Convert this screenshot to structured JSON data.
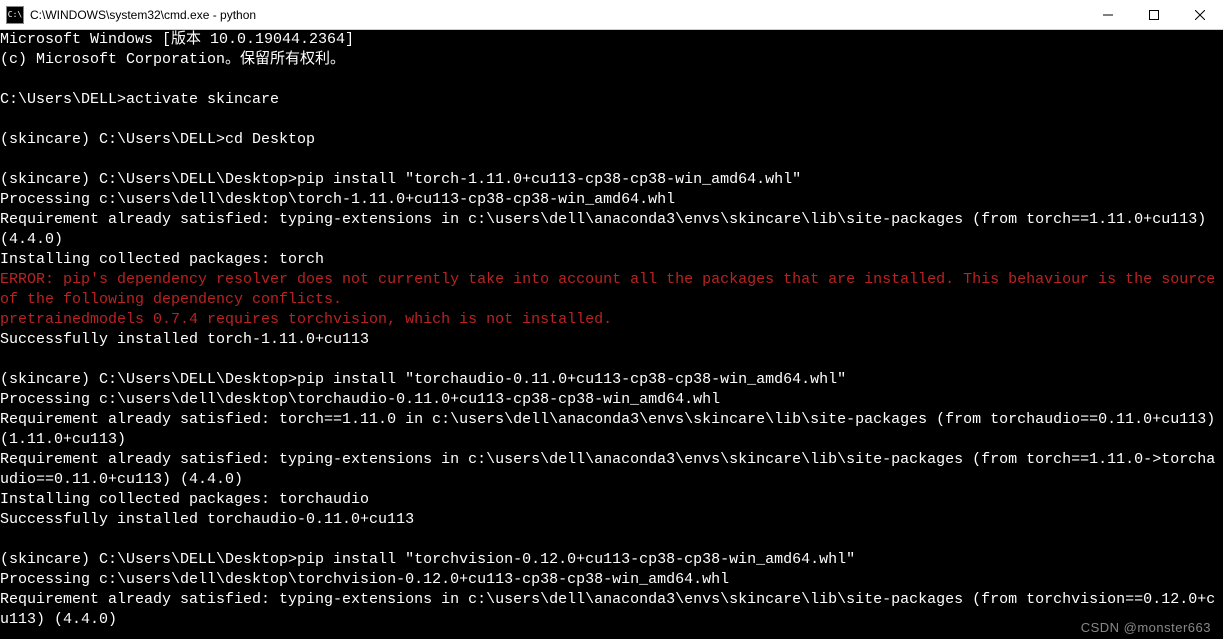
{
  "window": {
    "icon_label": "C:\\",
    "title": "C:\\WINDOWS\\system32\\cmd.exe - python"
  },
  "lines": [
    {
      "t": "Microsoft Windows [版本 10.0.19044.2364]",
      "c": "n"
    },
    {
      "t": "(c) Microsoft Corporation。保留所有权利。",
      "c": "n"
    },
    {
      "t": "",
      "c": "n"
    },
    {
      "t": "C:\\Users\\DELL>activate skincare",
      "c": "n"
    },
    {
      "t": "",
      "c": "n"
    },
    {
      "t": "(skincare) C:\\Users\\DELL>cd Desktop",
      "c": "n"
    },
    {
      "t": "",
      "c": "n"
    },
    {
      "t": "(skincare) C:\\Users\\DELL\\Desktop>pip install \"torch-1.11.0+cu113-cp38-cp38-win_amd64.whl\"",
      "c": "n"
    },
    {
      "t": "Processing c:\\users\\dell\\desktop\\torch-1.11.0+cu113-cp38-cp38-win_amd64.whl",
      "c": "n"
    },
    {
      "t": "Requirement already satisfied: typing-extensions in c:\\users\\dell\\anaconda3\\envs\\skincare\\lib\\site-packages (from torch==1.11.0+cu113) (4.4.0)",
      "c": "n"
    },
    {
      "t": "Installing collected packages: torch",
      "c": "n"
    },
    {
      "t": "ERROR: pip's dependency resolver does not currently take into account all the packages that are installed. This behaviour is the source of the following dependency conflicts.",
      "c": "e"
    },
    {
      "t": "pretrainedmodels 0.7.4 requires torchvision, which is not installed.",
      "c": "e"
    },
    {
      "t": "Successfully installed torch-1.11.0+cu113",
      "c": "n"
    },
    {
      "t": "",
      "c": "n"
    },
    {
      "t": "(skincare) C:\\Users\\DELL\\Desktop>pip install \"torchaudio-0.11.0+cu113-cp38-cp38-win_amd64.whl\"",
      "c": "n"
    },
    {
      "t": "Processing c:\\users\\dell\\desktop\\torchaudio-0.11.0+cu113-cp38-cp38-win_amd64.whl",
      "c": "n"
    },
    {
      "t": "Requirement already satisfied: torch==1.11.0 in c:\\users\\dell\\anaconda3\\envs\\skincare\\lib\\site-packages (from torchaudio==0.11.0+cu113) (1.11.0+cu113)",
      "c": "n"
    },
    {
      "t": "Requirement already satisfied: typing-extensions in c:\\users\\dell\\anaconda3\\envs\\skincare\\lib\\site-packages (from torch==1.11.0->torchaudio==0.11.0+cu113) (4.4.0)",
      "c": "n"
    },
    {
      "t": "Installing collected packages: torchaudio",
      "c": "n"
    },
    {
      "t": "Successfully installed torchaudio-0.11.0+cu113",
      "c": "n"
    },
    {
      "t": "",
      "c": "n"
    },
    {
      "t": "(skincare) C:\\Users\\DELL\\Desktop>pip install \"torchvision-0.12.0+cu113-cp38-cp38-win_amd64.whl\"",
      "c": "n"
    },
    {
      "t": "Processing c:\\users\\dell\\desktop\\torchvision-0.12.0+cu113-cp38-cp38-win_amd64.whl",
      "c": "n"
    },
    {
      "t": "Requirement already satisfied: typing-extensions in c:\\users\\dell\\anaconda3\\envs\\skincare\\lib\\site-packages (from torchvision==0.12.0+cu113) (4.4.0)",
      "c": "n"
    }
  ],
  "watermark": "CSDN @monster663"
}
